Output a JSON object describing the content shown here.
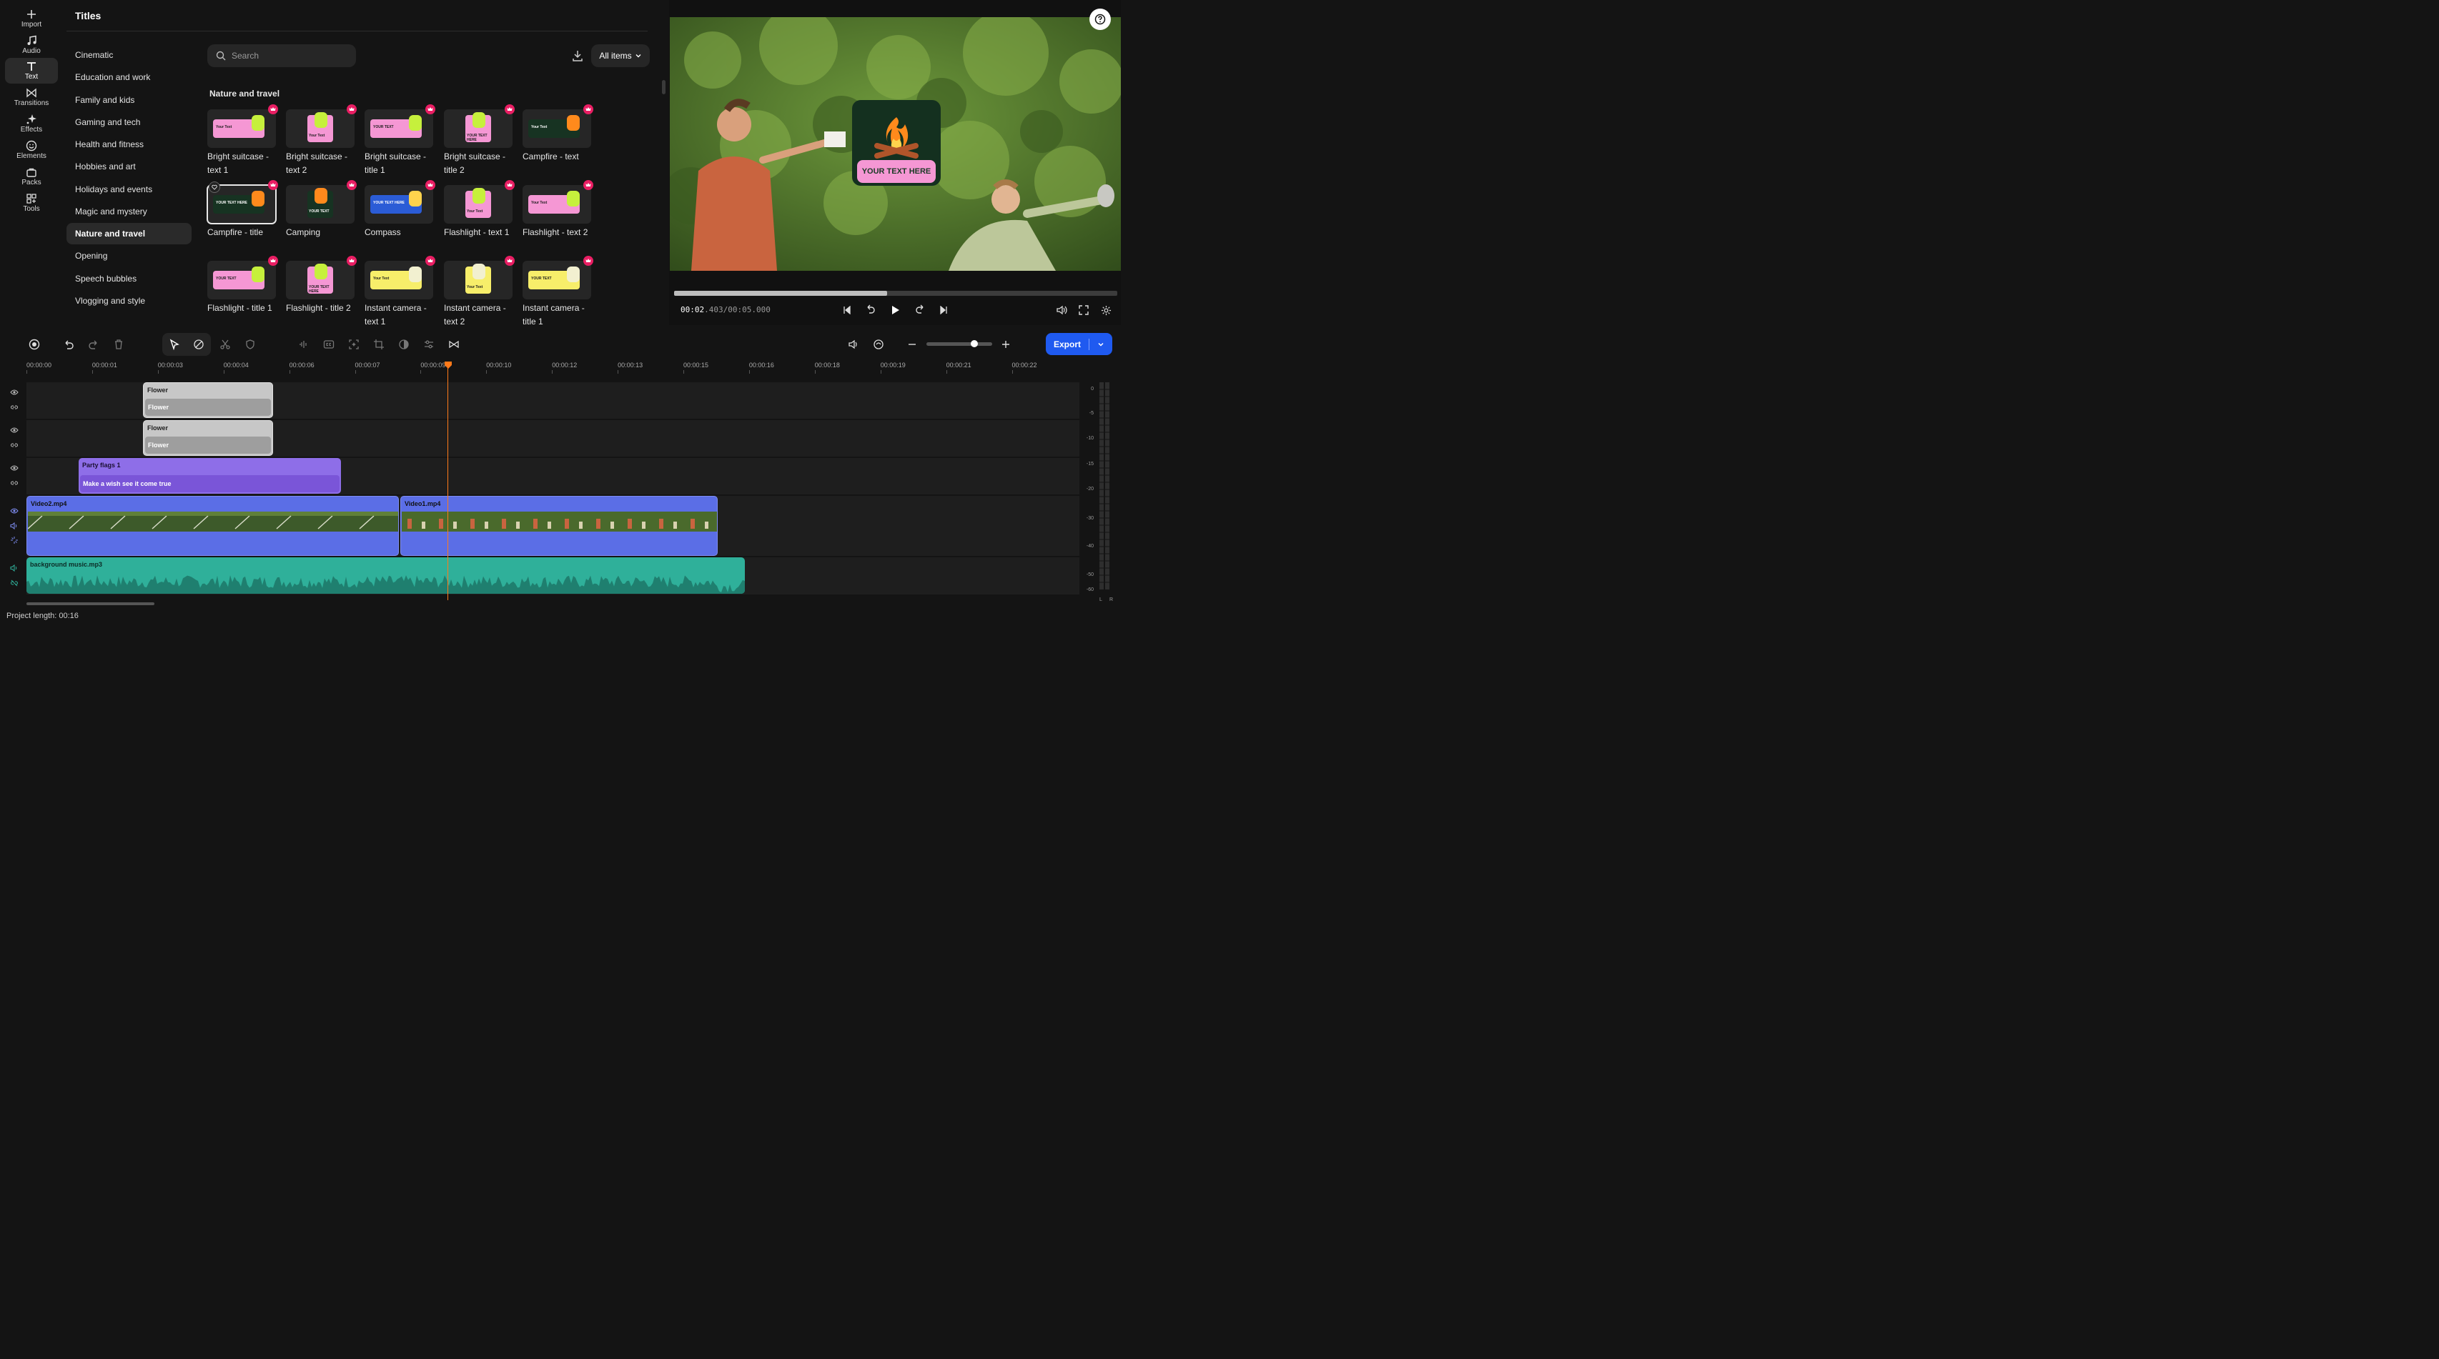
{
  "rail": [
    {
      "label": "Import",
      "icon": "plus-icon"
    },
    {
      "label": "Audio",
      "icon": "music-note-icon"
    },
    {
      "label": "Text",
      "icon": "text-t-icon",
      "active": true
    },
    {
      "label": "Transitions",
      "icon": "transitions-icon"
    },
    {
      "label": "Effects",
      "icon": "sparkle-icon"
    },
    {
      "label": "Elements",
      "icon": "smiley-icon"
    },
    {
      "label": "Packs",
      "icon": "bag-icon"
    },
    {
      "label": "Tools",
      "icon": "grid-plus-icon"
    }
  ],
  "panel": {
    "title": "Titles",
    "categories": [
      {
        "label": "Cinematic"
      },
      {
        "label": "Education and work"
      },
      {
        "label": "Family and kids"
      },
      {
        "label": "Gaming and tech"
      },
      {
        "label": "Health and fitness"
      },
      {
        "label": "Hobbies and art"
      },
      {
        "label": "Holidays and events"
      },
      {
        "label": "Magic and mystery"
      },
      {
        "label": "Nature and travel",
        "active": true
      },
      {
        "label": "Opening"
      },
      {
        "label": "Speech bubbles"
      },
      {
        "label": "Vlogging and style"
      }
    ],
    "search_placeholder": "Search",
    "filter_label": "All items",
    "section_title": "Nature and travel",
    "cards": [
      {
        "label": "Bright suitcase - text 1",
        "thumb_text": "Your Text",
        "theme": "pink"
      },
      {
        "label": "Bright suitcase - text 2",
        "thumb_text": "Your Text",
        "theme": "pink"
      },
      {
        "label": "Bright suitcase - title 1",
        "thumb_text": "YOUR TEXT",
        "theme": "pink"
      },
      {
        "label": "Bright suitcase - title 2",
        "thumb_text": "YOUR TEXT HERE",
        "theme": "pink"
      },
      {
        "label": "Campfire - text",
        "thumb_text": "Your Text",
        "theme": "green"
      },
      {
        "label": "Campfire - title",
        "thumb_text": "YOUR TEXT HERE",
        "theme": "green",
        "selected": true
      },
      {
        "label": "Camping",
        "thumb_text": "YOUR TEXT",
        "theme": "green"
      },
      {
        "label": "Compass",
        "thumb_text": "YOUR TEXT HERE",
        "theme": "blue"
      },
      {
        "label": "Flashlight - text 1",
        "thumb_text": "Your Text",
        "theme": "pink"
      },
      {
        "label": "Flashlight - text 2",
        "thumb_text": "Your Text",
        "theme": "pink"
      },
      {
        "label": "Flashlight - title 1",
        "thumb_text": "YOUR TEXT",
        "theme": "pink"
      },
      {
        "label": "Flashlight - title 2",
        "thumb_text": "YOUR TEXT HERE",
        "theme": "pink"
      },
      {
        "label": "Instant camera - text 1",
        "thumb_text": "Your Text",
        "theme": "yellow"
      },
      {
        "label": "Instant camera - text 2",
        "thumb_text": "Your Text",
        "theme": "yellow"
      },
      {
        "label": "Instant camera - title 1",
        "thumb_text": "YOUR TEXT",
        "theme": "yellow"
      }
    ]
  },
  "preview": {
    "overlay_text": "YOUR TEXT HERE",
    "time_current": "00:02",
    "time_rest": ".403/00:05.000",
    "progress": 0.48
  },
  "toolbar": {
    "export_label": "Export"
  },
  "ruler": [
    "00:00:00",
    "00:00:01",
    "00:00:03",
    "00:00:04",
    "00:00:06",
    "00:00:07",
    "00:00:09",
    "00:00:10",
    "00:00:12",
    "00:00:13",
    "00:00:15",
    "00:00:16",
    "00:00:18",
    "00:00:19",
    "00:00:21",
    "00:00:22"
  ],
  "tracks": {
    "flower1": {
      "name": "Flower",
      "sub": "Flower"
    },
    "flower2": {
      "name": "Flower",
      "sub": "Flower"
    },
    "party": {
      "name": "Party flags 1",
      "sub": "Make a wish see it come true"
    },
    "video2": {
      "name": "Video2.mp4"
    },
    "video1": {
      "name": "Video1.mp4"
    },
    "audio": {
      "name": "background music.mp3"
    }
  },
  "meter_scale": [
    "0",
    "-5",
    "-10",
    "-15",
    "-20",
    "-30",
    "-40",
    "-50",
    "-60"
  ],
  "meter_channels": [
    "L",
    "R"
  ],
  "project_length": "Project length: 00:16",
  "colors": {
    "accent": "#1f5af0",
    "playhead": "#ff7a1a",
    "crown": "#e91e63",
    "party": "#8e6ee8",
    "video": "#5b6ee6",
    "audio": "#2fb09a"
  }
}
